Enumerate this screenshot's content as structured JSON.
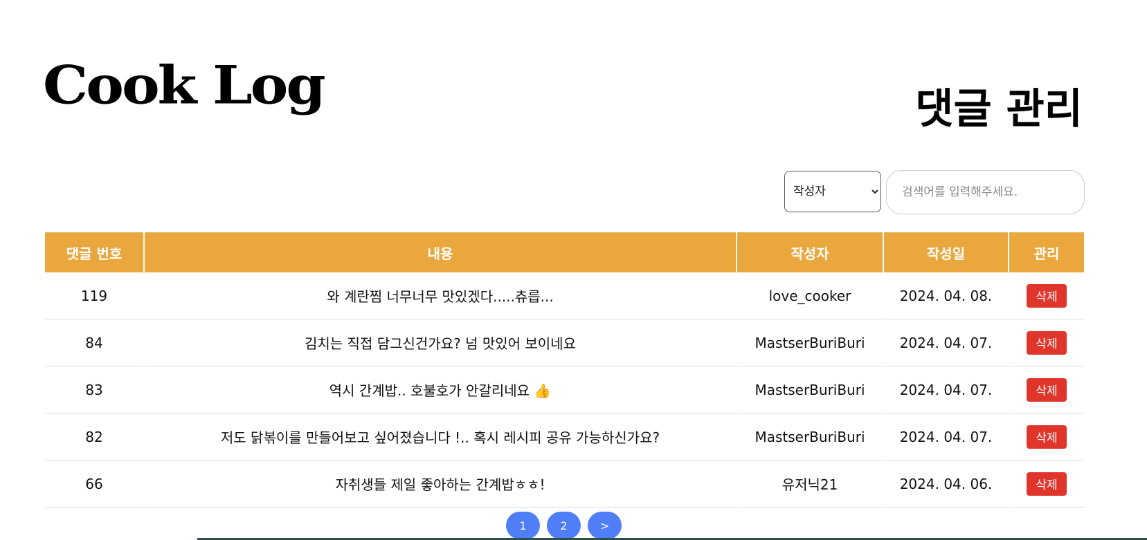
{
  "header": {
    "logo_text": "Cook Log",
    "page_title": "댓글 관리"
  },
  "search": {
    "filter_options": [
      "작성자"
    ],
    "filter_selected": "작성자",
    "placeholder": "검색어를 입력해주세요.",
    "value": ""
  },
  "table": {
    "columns": [
      "댓글 번호",
      "내용",
      "작성자",
      "작성일",
      "관리"
    ],
    "rows": [
      {
        "id": "119",
        "content": "와 계란찜 너무너무 맛있겠다.....츄릅...",
        "author": "love_cooker",
        "date": "2024. 04. 08.",
        "action": "삭제"
      },
      {
        "id": "84",
        "content": "김치는 직접 담그신건가요? 넘 맛있어 보이네요",
        "author": "MastserBuriBuri",
        "date": "2024. 04. 07.",
        "action": "삭제"
      },
      {
        "id": "83",
        "content": "역시 간계밥.. 호불호가 안갈리네요 👍",
        "author": "MastserBuriBuri",
        "date": "2024. 04. 07.",
        "action": "삭제"
      },
      {
        "id": "82",
        "content": "저도 닭볶이를 만들어보고 싶어졌습니다 !.. 혹시 레시피 공유 가능하신가요?",
        "author": "MastserBuriBuri",
        "date": "2024. 04. 07.",
        "action": "삭제"
      },
      {
        "id": "66",
        "content": "자취생들 제일 좋아하는 간계밥ㅎㅎ!",
        "author": "유저닉21",
        "date": "2024. 04. 06.",
        "action": "삭제"
      }
    ]
  },
  "pagination": {
    "pages": [
      "1",
      "2"
    ],
    "next_label": ">"
  },
  "colors": {
    "header_bg": "#e9a73d",
    "delete_button": "#e0352b",
    "page_button": "#4f7ef7"
  }
}
